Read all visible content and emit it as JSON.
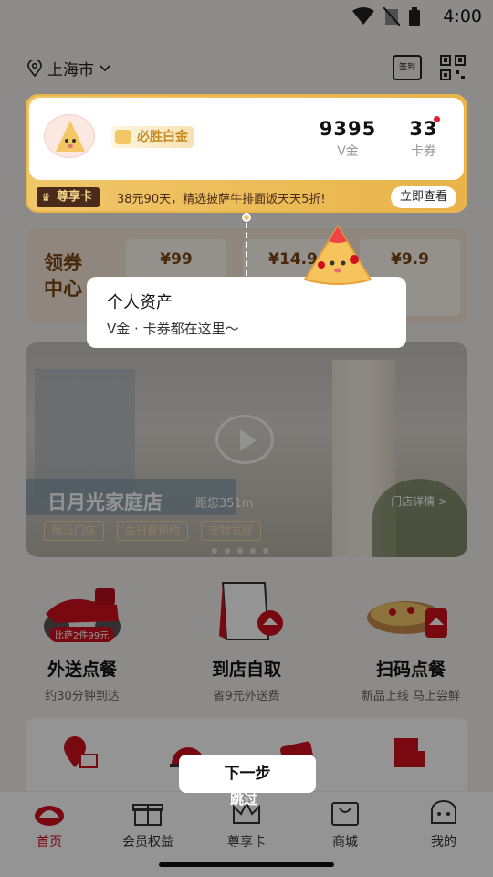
{
  "status": {
    "time": "4:00"
  },
  "header": {
    "city": "上海市",
    "sign_label": "签到"
  },
  "member": {
    "level": "必胜白金",
    "vgold_value": "9395",
    "vgold_label": "V金",
    "coupons_value": "33",
    "coupons_label": "卡券",
    "vip_tag": "尊享卡",
    "promo": "38元90天，精选披萨牛排面饭天天5折!",
    "view_label": "立即查看"
  },
  "coupon_center": {
    "title": "领券中心",
    "prices": [
      "¥99",
      "¥14.9",
      "¥9.9"
    ]
  },
  "store": {
    "name": "日月光家庭店",
    "distance": "距您351m",
    "detail": "门店详情 >",
    "tags": [
      "附近门店",
      "生日餐预约",
      "宠物友好"
    ]
  },
  "services": [
    {
      "title": "外送点餐",
      "sub": "约30分钟到达",
      "badge": "比萨2件99元"
    },
    {
      "title": "到店自取",
      "sub": "省9元外送费"
    },
    {
      "title": "扫码点餐",
      "sub": "新品上线 马上尝鲜"
    }
  ],
  "tooltip": {
    "title": "个人资产",
    "body": "V金 · 卡券都在这里～"
  },
  "guide": {
    "next_label": "下一步",
    "skip_label": "跳过"
  },
  "tabs": [
    {
      "label": "首页"
    },
    {
      "label": "会员权益"
    },
    {
      "label": "尊享卡"
    },
    {
      "label": "商城"
    },
    {
      "label": "我的"
    }
  ],
  "colors": {
    "brand_red": "#d0101e",
    "gold": "#e9b54a"
  }
}
